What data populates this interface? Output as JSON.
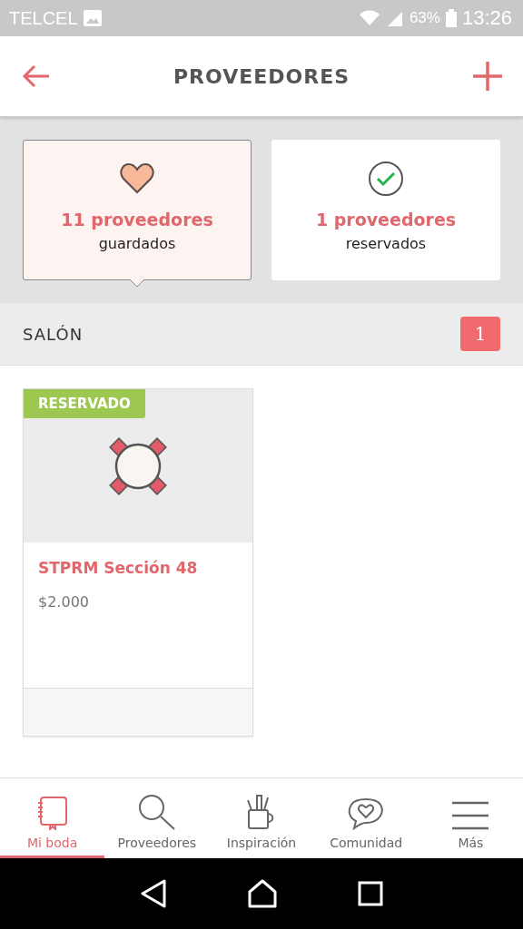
{
  "status_bar": {
    "carrier": "TELCEL",
    "battery": "63%",
    "time": "13:26"
  },
  "header": {
    "title": "PROVEEDORES"
  },
  "summary": [
    {
      "kind": "heart",
      "count": "11 proveedores",
      "label": "guardados",
      "selected": true
    },
    {
      "kind": "check",
      "count": "1 proveedores",
      "label": "reservados",
      "selected": false
    }
  ],
  "section": {
    "title": "SALÓN",
    "badge": "1"
  },
  "vendors": [
    {
      "tag": "RESERVADO",
      "name": "STPRM Sección 48",
      "price": "$2.000"
    }
  ],
  "tabs": [
    {
      "kind": "notebook",
      "label": "Mi boda",
      "selected": true
    },
    {
      "kind": "search",
      "label": "Proveedores",
      "selected": false
    },
    {
      "kind": "cup",
      "label": "Inspiración",
      "selected": false
    },
    {
      "kind": "chat",
      "label": "Comunidad",
      "selected": false
    },
    {
      "kind": "menu",
      "label": "Más",
      "selected": false
    }
  ]
}
